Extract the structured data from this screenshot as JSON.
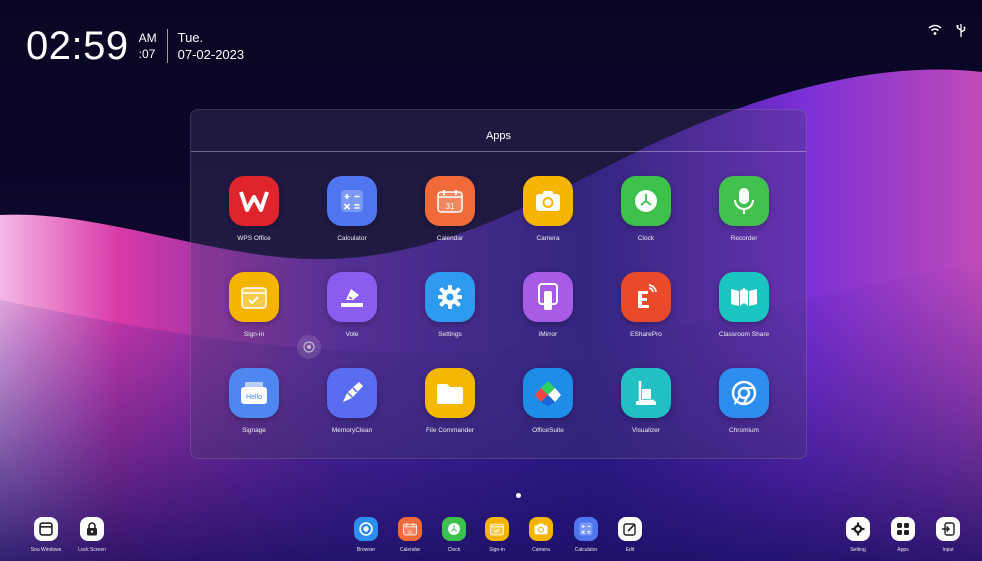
{
  "clock": {
    "time": "02:59",
    "ampm": "AM",
    "seconds": ":07",
    "day": "Tue.",
    "date": "07-02-2023"
  },
  "status": {
    "wifi_icon": "wifi-icon",
    "usb_icon": "usb-icon"
  },
  "apps_panel": {
    "title": "Apps",
    "apps": [
      {
        "label": "WPS Office",
        "icon": "wps-office-icon",
        "color": "#e0242e"
      },
      {
        "label": "Calculator",
        "icon": "calculator-icon",
        "color": "#4f76f0"
      },
      {
        "label": "Calendar",
        "icon": "calendar-icon",
        "color": "#f06a3a"
      },
      {
        "label": "Camera",
        "icon": "camera-icon",
        "color": "#f5b400"
      },
      {
        "label": "Clock",
        "icon": "clock-icon",
        "color": "#3cc24a"
      },
      {
        "label": "Recorder",
        "icon": "microphone-icon",
        "color": "#43c14e"
      },
      {
        "label": "Sign-in",
        "icon": "sign-in-icon",
        "color": "#f5b400"
      },
      {
        "label": "Vote",
        "icon": "vote-icon",
        "color": "#8a5cf0"
      },
      {
        "label": "Settings",
        "icon": "settings-icon",
        "color": "#2f9bf0"
      },
      {
        "label": "iMirror",
        "icon": "mirror-icon",
        "color": "#a85ce6"
      },
      {
        "label": "EShare​Pro",
        "icon": "eshare-icon",
        "color": "#e84a2a"
      },
      {
        "label": "Classroom Share",
        "icon": "classroom-share-icon",
        "color": "#1cc6c0"
      },
      {
        "label": "Signage",
        "icon": "signage-icon",
        "color": "#4f86f0"
      },
      {
        "label": "MemoryClean",
        "icon": "memory-clean-icon",
        "color": "#5a6cf0"
      },
      {
        "label": "File Commander",
        "icon": "folder-icon",
        "color": "#f5b800"
      },
      {
        "label": "OfficeSuite",
        "icon": "officesuite-icon",
        "color": "#1e8de8"
      },
      {
        "label": "Visualizer",
        "icon": "visualizer-icon",
        "color": "#22bfc4"
      },
      {
        "label": "Chromium",
        "icon": "chromium-icon",
        "color": "#2c8ff0"
      }
    ]
  },
  "dock": {
    "left": [
      {
        "label": "Sou Windows",
        "icon": "window-icon"
      },
      {
        "label": "Lock Screen",
        "icon": "lock-icon"
      }
    ],
    "center": [
      {
        "label": "Browser",
        "icon": "browser-icon",
        "color": "#2c8ff0"
      },
      {
        "label": "Calendar",
        "icon": "calendar-icon",
        "color": "#f06a3a"
      },
      {
        "label": "Clock",
        "icon": "clock-icon",
        "color": "#3cc24a"
      },
      {
        "label": "Sign-in",
        "icon": "sign-in-icon",
        "color": "#f5b400"
      },
      {
        "label": "Camera",
        "icon": "camera-icon",
        "color": "#f5b400"
      },
      {
        "label": "Calculator",
        "icon": "calculator-icon",
        "color": "#4f76f0"
      },
      {
        "label": "Edit",
        "icon": "edit-icon",
        "color": "#ffffff"
      }
    ],
    "right": [
      {
        "label": "Setting",
        "icon": "gear-icon"
      },
      {
        "label": "Apps",
        "icon": "apps-icon"
      },
      {
        "label": "Input",
        "icon": "input-icon"
      }
    ]
  }
}
